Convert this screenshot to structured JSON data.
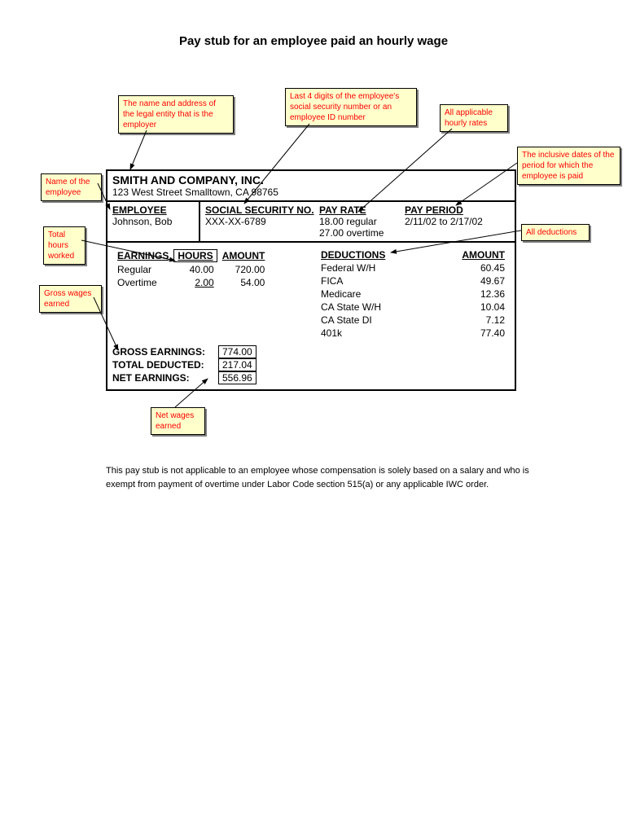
{
  "title": "Pay stub for an employee paid an hourly wage",
  "callouts": {
    "employer": "The name and address of the legal entity that is the employer",
    "ssn": "Last 4 digits of the employee's social security number or an employee ID number",
    "rates": "All applicable hourly rates",
    "period": "The inclusive dates of the period for which the employee is paid",
    "employee_name": "Name of the employee",
    "hours": "Total hours worked",
    "deductions": "All deductions",
    "gross": "Gross wages earned",
    "net": "Net wages earned"
  },
  "company": {
    "name": "SMITH AND COMPANY, INC.",
    "address": "123 West Street Smalltown, CA  98765"
  },
  "headers": {
    "employee": "EMPLOYEE",
    "ssn": "SOCIAL SECURITY NO.",
    "payrate": "PAY RATE",
    "payperiod": "PAY PERIOD",
    "earnings": "EARNINGS",
    "hours": "HOURS",
    "amount": "AMOUNT",
    "deductions": "DEDUCTIONS",
    "amount2": "AMOUNT"
  },
  "employee": {
    "name": "Johnson, Bob",
    "ssn": "XXX-XX-6789",
    "rate1": "18.00 regular",
    "rate2": "27.00 overtime",
    "period": "2/11/02 to 2/17/02"
  },
  "earnings": [
    {
      "label": "Regular",
      "hours": "40.00",
      "amount": "720.00"
    },
    {
      "label": "Overtime",
      "hours": "2.00",
      "amount": "54.00"
    }
  ],
  "deductions": [
    {
      "label": "Federal W/H",
      "amount": "60.45"
    },
    {
      "label": "FICA",
      "amount": "49.67"
    },
    {
      "label": "Medicare",
      "amount": "12.36"
    },
    {
      "label": "CA State W/H",
      "amount": "10.04"
    },
    {
      "label": "CA State DI",
      "amount": "7.12"
    },
    {
      "label": "401k",
      "amount": "77.40"
    }
  ],
  "totals": {
    "gross_label": "GROSS EARNINGS:",
    "gross": "774.00",
    "deducted_label": "TOTAL DEDUCTED:",
    "deducted": "217.04",
    "net_label": "NET EARNINGS:",
    "net": "556.96"
  },
  "footer": "This pay stub is not applicable to an employee whose compensation is solely based on a salary and who is exempt from payment of overtime under Labor Code section 515(a) or any applicable IWC order."
}
